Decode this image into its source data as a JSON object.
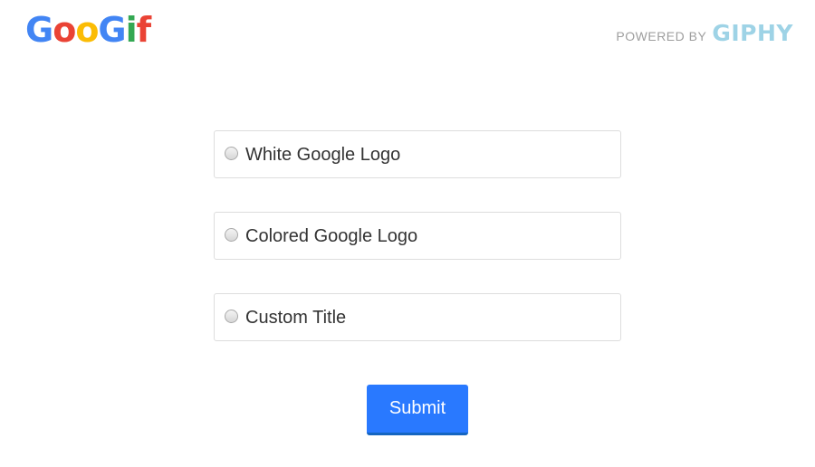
{
  "header": {
    "logo_letters": [
      {
        "char": "G",
        "color": "#4285F4"
      },
      {
        "char": "o",
        "color": "#EA4335"
      },
      {
        "char": "o",
        "color": "#FBBC05"
      },
      {
        "char": "G",
        "color": "#4285F4"
      },
      {
        "char": "i",
        "color": "#34A853"
      },
      {
        "char": "f",
        "color": "#EA4335"
      }
    ],
    "powered_label": "POWERED BY",
    "powered_brand": "GIPHY"
  },
  "options": [
    {
      "label": "White Google Logo",
      "selected": false
    },
    {
      "label": "Colored Google Logo",
      "selected": false
    },
    {
      "label": "Custom Title",
      "selected": false
    }
  ],
  "submit_label": "Submit",
  "colors": {
    "accent": "#2979ff",
    "giphy": "#9ed3e6"
  }
}
